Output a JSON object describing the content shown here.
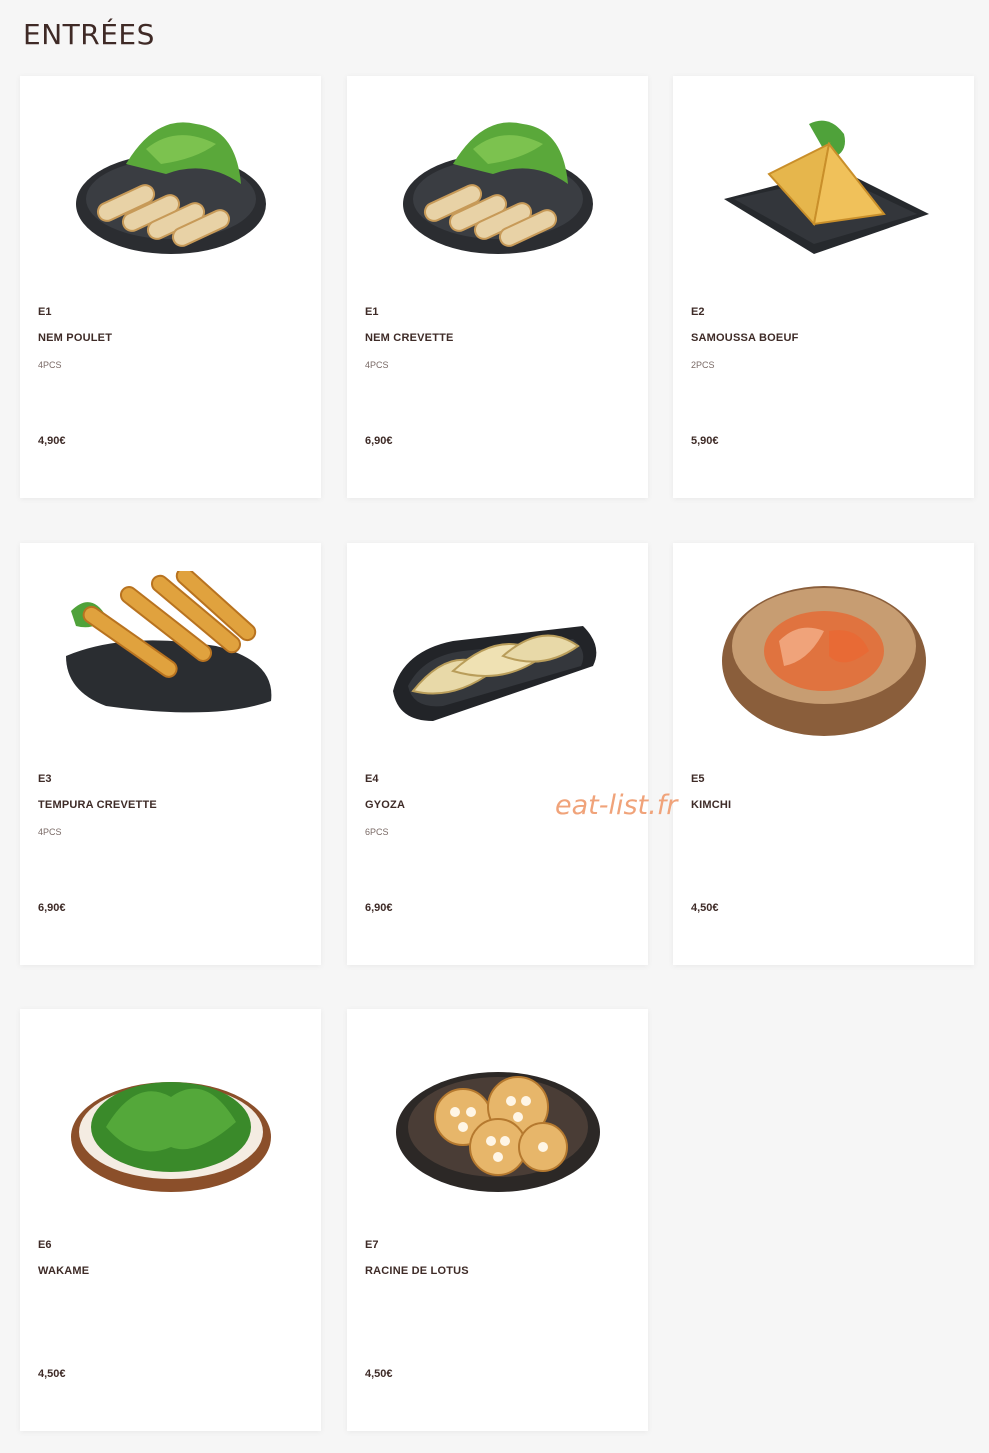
{
  "page": {
    "title": "ENTRÉES"
  },
  "watermark": "eat-list.fr",
  "items": [
    {
      "code": "E1",
      "name": "NEM POULET",
      "qty": "4PCS",
      "price": "4,90€",
      "icon": "spring-rolls-image"
    },
    {
      "code": "E1",
      "name": "NEM CREVETTE",
      "qty": "4PCS",
      "price": "6,90€",
      "icon": "spring-rolls-image"
    },
    {
      "code": "E2",
      "name": "SAMOUSSA BOEUF",
      "qty": "2PCS",
      "price": "5,90€",
      "icon": "samosa-image"
    },
    {
      "code": "E3",
      "name": "TEMPURA CREVETTE",
      "qty": "4PCS",
      "price": "6,90€",
      "icon": "tempura-image"
    },
    {
      "code": "E4",
      "name": "GYOZA",
      "qty": "6PCS",
      "price": "6,90€",
      "icon": "gyoza-image"
    },
    {
      "code": "E5",
      "name": "KIMCHI",
      "qty": "",
      "price": "4,50€",
      "icon": "kimchi-image"
    },
    {
      "code": "E6",
      "name": "WAKAME",
      "qty": "",
      "price": "4,50€",
      "icon": "wakame-image"
    },
    {
      "code": "E7",
      "name": "RACINE DE LOTUS",
      "qty": "",
      "price": "4,50€",
      "icon": "lotus-root-image"
    }
  ]
}
